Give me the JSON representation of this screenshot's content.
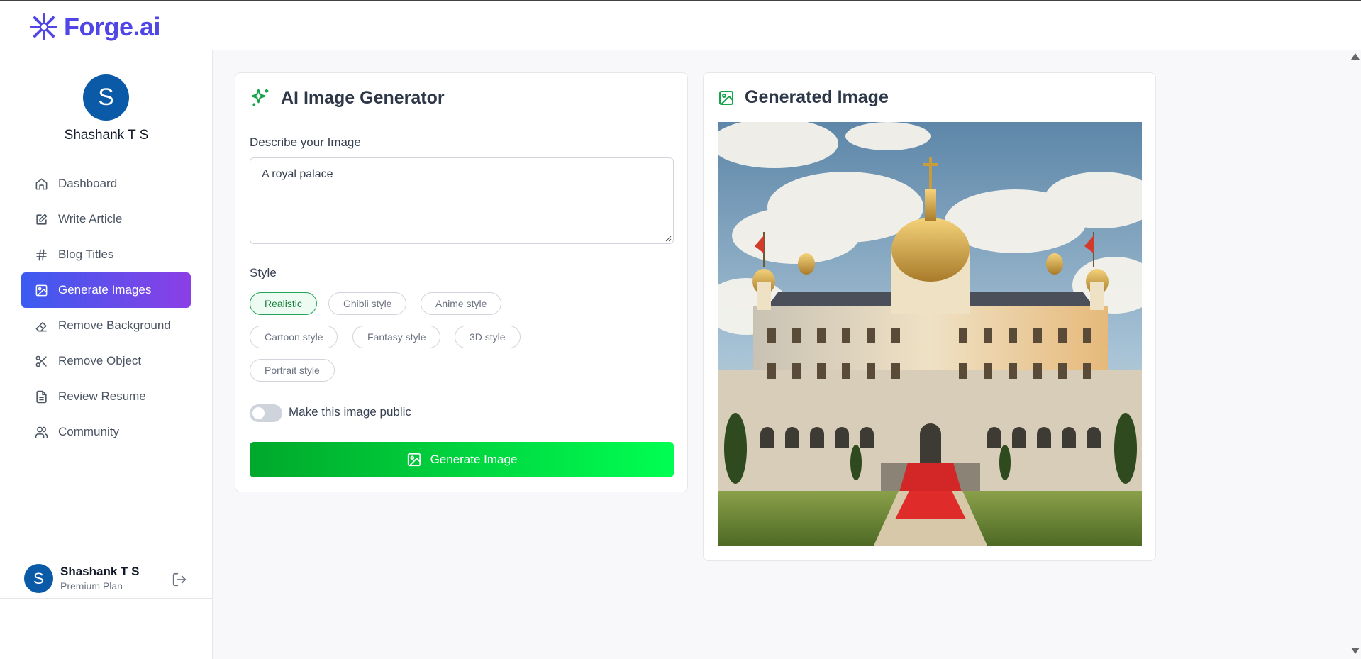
{
  "brand": {
    "name": "Forge.ai",
    "color": "#4f46e5"
  },
  "user": {
    "initial": "S",
    "name": "Shashank T S",
    "plan": "Premium Plan"
  },
  "sidebar": {
    "items": [
      {
        "label": "Dashboard",
        "icon": "home-icon"
      },
      {
        "label": "Write Article",
        "icon": "edit-icon"
      },
      {
        "label": "Blog Titles",
        "icon": "hash-icon"
      },
      {
        "label": "Generate Images",
        "icon": "image-icon",
        "active": true
      },
      {
        "label": "Remove Background",
        "icon": "eraser-icon"
      },
      {
        "label": "Remove Object",
        "icon": "scissors-icon"
      },
      {
        "label": "Review Resume",
        "icon": "file-text-icon"
      },
      {
        "label": "Community",
        "icon": "users-icon"
      }
    ]
  },
  "generator": {
    "title": "AI Image Generator",
    "prompt_label": "Describe your Image",
    "prompt_value": "A royal palace",
    "style_label": "Style",
    "styles": [
      "Realistic",
      "Ghibli style",
      "Anime style",
      "Cartoon style",
      "Fantasy style",
      "3D style",
      "Portrait style"
    ],
    "selected_style": "Realistic",
    "public_toggle_label": "Make this image public",
    "public_toggle_on": false,
    "generate_label": "Generate Image",
    "accent_color": "#00c93a"
  },
  "result": {
    "title": "Generated Image"
  }
}
